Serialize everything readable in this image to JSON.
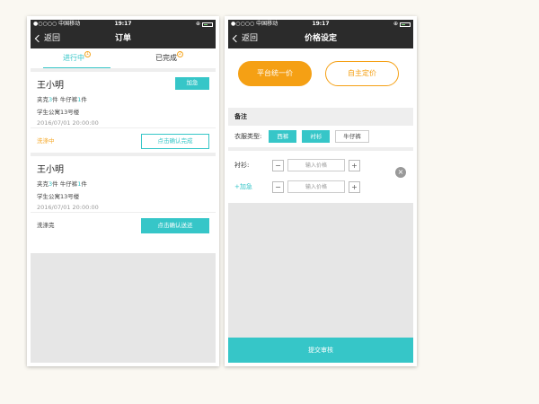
{
  "status_bar": {
    "carrier": "●○○○○ 中国移动",
    "time": "19:17"
  },
  "left": {
    "nav": {
      "back_label": "返回",
      "title": "订单"
    },
    "tabs": [
      {
        "label": "进行中",
        "badge": "1"
      },
      {
        "label": "已完成",
        "badge": "2"
      }
    ],
    "orders": [
      {
        "customer": "王小明",
        "items_prefix": "夹克",
        "items_num1": "3",
        "items_mid": "件  牛仔裤",
        "items_num2": "1",
        "items_suffix": "件",
        "address": "学生公寓13号楼",
        "datetime": "2016/07/01   20:00:00",
        "urgent_label": "加急",
        "status": "洗涤中",
        "action_label": "点击确认完成"
      },
      {
        "customer": "王小明",
        "items_prefix": "夹克",
        "items_num1": "3",
        "items_mid": "件  牛仔裤",
        "items_num2": "1",
        "items_suffix": "件",
        "address": "学生公寓13号楼",
        "datetime": "2016/07/01   20:00:00",
        "status": "洗涤完",
        "action_label": "点击确认送还"
      }
    ]
  },
  "right": {
    "nav": {
      "back_label": "返回",
      "title": "价格设定"
    },
    "price_modes": {
      "platform": "平台统一价",
      "custom": "自主定价"
    },
    "remark_label": "备注",
    "clothes_type_label": "衣服类型:",
    "clothes_types": [
      "西裤",
      "衬衫",
      "牛仔裤"
    ],
    "price_rows": [
      {
        "label": "衬衫:",
        "placeholder": "输入价格"
      },
      {
        "label": "+加急",
        "placeholder": "输入价格"
      }
    ],
    "submit_label": "提交审核"
  },
  "colors": {
    "accent": "#36c6c8",
    "orange": "#f5a014",
    "navbar": "#2b2b2b"
  }
}
